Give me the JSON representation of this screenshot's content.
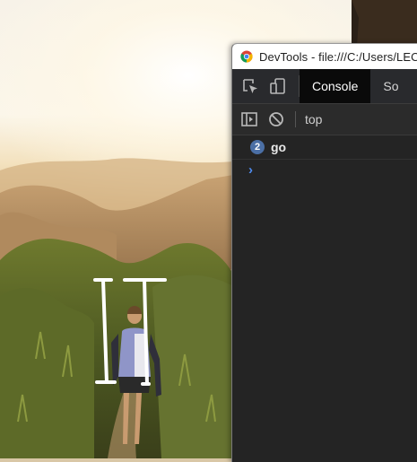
{
  "window": {
    "title": "DevTools - file:///C:/Users/LEO/"
  },
  "devtools": {
    "tabs": [
      {
        "label": "Console",
        "active": true
      },
      {
        "label": "So",
        "active": false
      }
    ],
    "toolbar": {
      "context": "top"
    },
    "messages": [
      {
        "repeat_count": "2",
        "text": "go"
      }
    ],
    "prompt_symbol": "›"
  },
  "icons": {
    "inspect": "inspect-element-icon",
    "device": "device-toolbar-icon",
    "sidebar": "show-sidebar-icon",
    "clear": "clear-console-icon",
    "browser": "chrome-icon"
  },
  "colors": {
    "accent_blue": "#4f8cf0",
    "badge": "#4b6fa5",
    "active_tab": "#0a0a0a",
    "panel_bg": "#242424"
  }
}
